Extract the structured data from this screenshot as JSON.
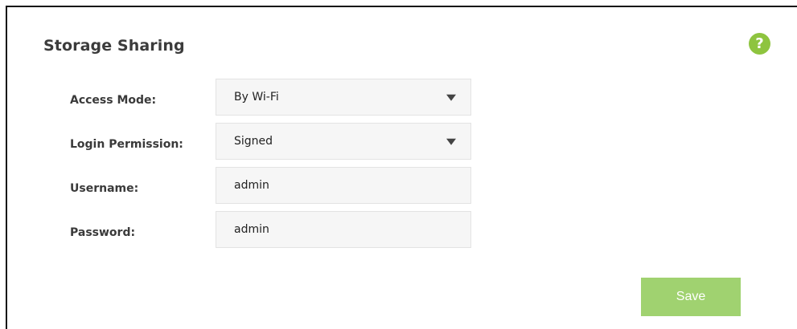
{
  "page": {
    "title": "Storage Sharing",
    "help_glyph": "?",
    "help_icon": "help-icon",
    "accent_color": "#8ec43f"
  },
  "form": {
    "access_mode": {
      "label": "Access Mode:",
      "value": "By Wi-Fi"
    },
    "login_permission": {
      "label": "Login Permission:",
      "value": "Signed"
    },
    "username": {
      "label": "Username:",
      "value": "admin"
    },
    "password": {
      "label": "Password:",
      "value": "admin"
    }
  },
  "actions": {
    "save_label": "Save",
    "save_color": "#a0d270"
  }
}
